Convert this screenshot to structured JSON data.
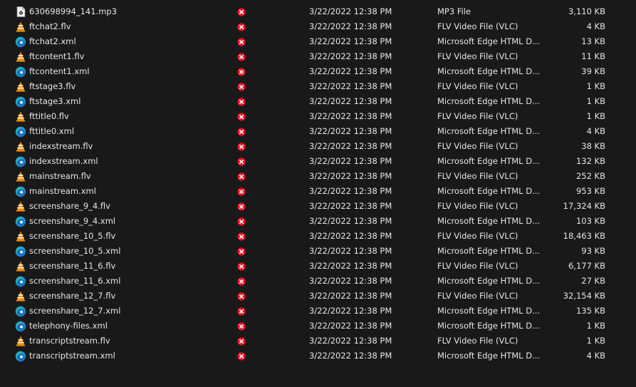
{
  "files": [
    {
      "icon": "mp3-file-icon",
      "name": "630698994_141.mp3",
      "status": "sync-error-icon",
      "date": "3/22/2022 12:38 PM",
      "type": "MP3 File",
      "size": "3,110 KB"
    },
    {
      "icon": "vlc-cone-icon",
      "name": "ftchat2.flv",
      "status": "sync-error-icon",
      "date": "3/22/2022 12:38 PM",
      "type": "FLV Video File (VLC)",
      "size": "4 KB"
    },
    {
      "icon": "edge-icon",
      "name": "ftchat2.xml",
      "status": "sync-error-icon",
      "date": "3/22/2022 12:38 PM",
      "type": "Microsoft Edge HTML D...",
      "size": "13 KB"
    },
    {
      "icon": "vlc-cone-icon",
      "name": "ftcontent1.flv",
      "status": "sync-error-icon",
      "date": "3/22/2022 12:38 PM",
      "type": "FLV Video File (VLC)",
      "size": "11 KB"
    },
    {
      "icon": "edge-icon",
      "name": "ftcontent1.xml",
      "status": "sync-error-icon",
      "date": "3/22/2022 12:38 PM",
      "type": "Microsoft Edge HTML D...",
      "size": "39 KB"
    },
    {
      "icon": "vlc-cone-icon",
      "name": "ftstage3.flv",
      "status": "sync-error-icon",
      "date": "3/22/2022 12:38 PM",
      "type": "FLV Video File (VLC)",
      "size": "1 KB"
    },
    {
      "icon": "edge-icon",
      "name": "ftstage3.xml",
      "status": "sync-error-icon",
      "date": "3/22/2022 12:38 PM",
      "type": "Microsoft Edge HTML D...",
      "size": "1 KB"
    },
    {
      "icon": "vlc-cone-icon",
      "name": "fttitle0.flv",
      "status": "sync-error-icon",
      "date": "3/22/2022 12:38 PM",
      "type": "FLV Video File (VLC)",
      "size": "1 KB"
    },
    {
      "icon": "edge-icon",
      "name": "fttitle0.xml",
      "status": "sync-error-icon",
      "date": "3/22/2022 12:38 PM",
      "type": "Microsoft Edge HTML D...",
      "size": "4 KB"
    },
    {
      "icon": "vlc-cone-icon",
      "name": "indexstream.flv",
      "status": "sync-error-icon",
      "date": "3/22/2022 12:38 PM",
      "type": "FLV Video File (VLC)",
      "size": "38 KB"
    },
    {
      "icon": "edge-icon",
      "name": "indexstream.xml",
      "status": "sync-error-icon",
      "date": "3/22/2022 12:38 PM",
      "type": "Microsoft Edge HTML D...",
      "size": "132 KB"
    },
    {
      "icon": "vlc-cone-icon",
      "name": "mainstream.flv",
      "status": "sync-error-icon",
      "date": "3/22/2022 12:38 PM",
      "type": "FLV Video File (VLC)",
      "size": "252 KB"
    },
    {
      "icon": "edge-icon",
      "name": "mainstream.xml",
      "status": "sync-error-icon",
      "date": "3/22/2022 12:38 PM",
      "type": "Microsoft Edge HTML D...",
      "size": "953 KB"
    },
    {
      "icon": "vlc-cone-icon",
      "name": "screenshare_9_4.flv",
      "status": "sync-error-icon",
      "date": "3/22/2022 12:38 PM",
      "type": "FLV Video File (VLC)",
      "size": "17,324 KB"
    },
    {
      "icon": "edge-icon",
      "name": "screenshare_9_4.xml",
      "status": "sync-error-icon",
      "date": "3/22/2022 12:38 PM",
      "type": "Microsoft Edge HTML D...",
      "size": "103 KB"
    },
    {
      "icon": "vlc-cone-icon",
      "name": "screenshare_10_5.flv",
      "status": "sync-error-icon",
      "date": "3/22/2022 12:38 PM",
      "type": "FLV Video File (VLC)",
      "size": "18,463 KB"
    },
    {
      "icon": "edge-icon",
      "name": "screenshare_10_5.xml",
      "status": "sync-error-icon",
      "date": "3/22/2022 12:38 PM",
      "type": "Microsoft Edge HTML D...",
      "size": "93 KB"
    },
    {
      "icon": "vlc-cone-icon",
      "name": "screenshare_11_6.flv",
      "status": "sync-error-icon",
      "date": "3/22/2022 12:38 PM",
      "type": "FLV Video File (VLC)",
      "size": "6,177 KB"
    },
    {
      "icon": "edge-icon",
      "name": "screenshare_11_6.xml",
      "status": "sync-error-icon",
      "date": "3/22/2022 12:38 PM",
      "type": "Microsoft Edge HTML D...",
      "size": "27 KB"
    },
    {
      "icon": "vlc-cone-icon",
      "name": "screenshare_12_7.flv",
      "status": "sync-error-icon",
      "date": "3/22/2022 12:38 PM",
      "type": "FLV Video File (VLC)",
      "size": "32,154 KB"
    },
    {
      "icon": "edge-icon",
      "name": "screenshare_12_7.xml",
      "status": "sync-error-icon",
      "date": "3/22/2022 12:38 PM",
      "type": "Microsoft Edge HTML D...",
      "size": "135 KB"
    },
    {
      "icon": "edge-icon",
      "name": "telephony-files.xml",
      "status": "sync-error-icon",
      "date": "3/22/2022 12:38 PM",
      "type": "Microsoft Edge HTML D...",
      "size": "1 KB"
    },
    {
      "icon": "vlc-cone-icon",
      "name": "transcriptstream.flv",
      "status": "sync-error-icon",
      "date": "3/22/2022 12:38 PM",
      "type": "FLV Video File (VLC)",
      "size": "1 KB"
    },
    {
      "icon": "edge-icon",
      "name": "transcriptstream.xml",
      "status": "sync-error-icon",
      "date": "3/22/2022 12:38 PM",
      "type": "Microsoft Edge HTML D...",
      "size": "4 KB"
    }
  ],
  "colors": {
    "background": "#191919",
    "text": "#e6e6e6",
    "error": "#e81123",
    "vlc_orange": "#f08a00",
    "edge_blue": "#0f7cd6",
    "edge_teal": "#36c29a"
  }
}
